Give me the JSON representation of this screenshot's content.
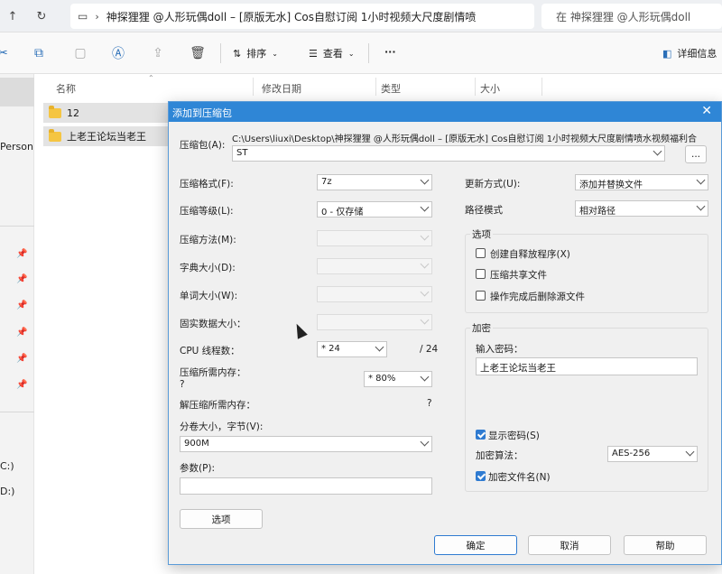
{
  "explorer": {
    "address": "神探狸狸 @人形玩偶doll – [原版无水] Cos自慰订阅 1小时视频大尺度剧情喷",
    "search_placeholder": "在 神探狸狸 @人形玩偶doll",
    "toolbar": {
      "sort_label": "排序",
      "view_label": "查看",
      "more": "···",
      "details_label": "详细信息"
    },
    "left_items": [
      "Person",
      "C:)",
      "D:)"
    ],
    "columns": [
      "名称",
      "修改日期",
      "类型",
      "大小"
    ],
    "files": [
      "12",
      "上老王论坛当老王"
    ]
  },
  "dialog": {
    "title": "添加到压缩包",
    "archive_label": "压缩包(A):",
    "archive_path": "C:\\Users\\liuxi\\Desktop\\神探狸狸 @人形玩偶doll – [原版无水] Cos自慰订阅 1小时视频大尺度剧情喷水视频福利合",
    "archive_name": "ST",
    "browse": "...",
    "left": {
      "format_label": "压缩格式(F):",
      "format_value": "7z",
      "level_label": "压缩等级(L):",
      "level_value": "0 - 仅存储",
      "method_label": "压缩方法(M):",
      "dict_label": "字典大小(D):",
      "word_label": "单词大小(W):",
      "solid_label": "固实数据大小：",
      "cpu_label": "CPU 线程数：",
      "cpu_value": "* 24",
      "cpu_total": "/ 24",
      "mem_label": "压缩所需内存：",
      "mem_hint": "?",
      "mem_value": "* 80%",
      "unmem_label": "解压缩所需内存：",
      "unmem_value": "?",
      "split_label": "分卷大小，字节(V):",
      "split_value": "900M",
      "params_label": "参数(P):",
      "options_btn": "选项"
    },
    "right": {
      "update_label": "更新方式(U):",
      "update_value": "添加并替换文件",
      "path_label": "路径模式",
      "path_value": "相对路径",
      "options_group": "选项",
      "opt_sfx": "创建自释放程序(X)",
      "opt_shared": "压缩共享文件",
      "opt_delete": "操作完成后删除源文件",
      "enc_group": "加密",
      "pwd_label": "输入密码：",
      "pwd_value": "上老王论坛当老王",
      "show_pwd": "显示密码(S)",
      "enc_method_label": "加密算法：",
      "enc_method_value": "AES-256",
      "enc_names": "加密文件名(N)"
    },
    "buttons": {
      "ok": "确定",
      "cancel": "取消",
      "help": "帮助"
    }
  }
}
